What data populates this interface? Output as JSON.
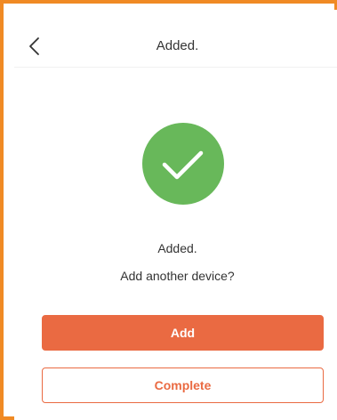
{
  "header": {
    "title": "Added.",
    "back_icon": "chevron-left-icon"
  },
  "status": {
    "icon": "check-circle-icon",
    "icon_color": "#68b85a",
    "message": "Added.",
    "prompt": "Add another device?"
  },
  "actions": {
    "add_label": "Add",
    "complete_label": "Complete",
    "accent_color": "#ea6a42"
  },
  "frame_color": "#f08a24"
}
